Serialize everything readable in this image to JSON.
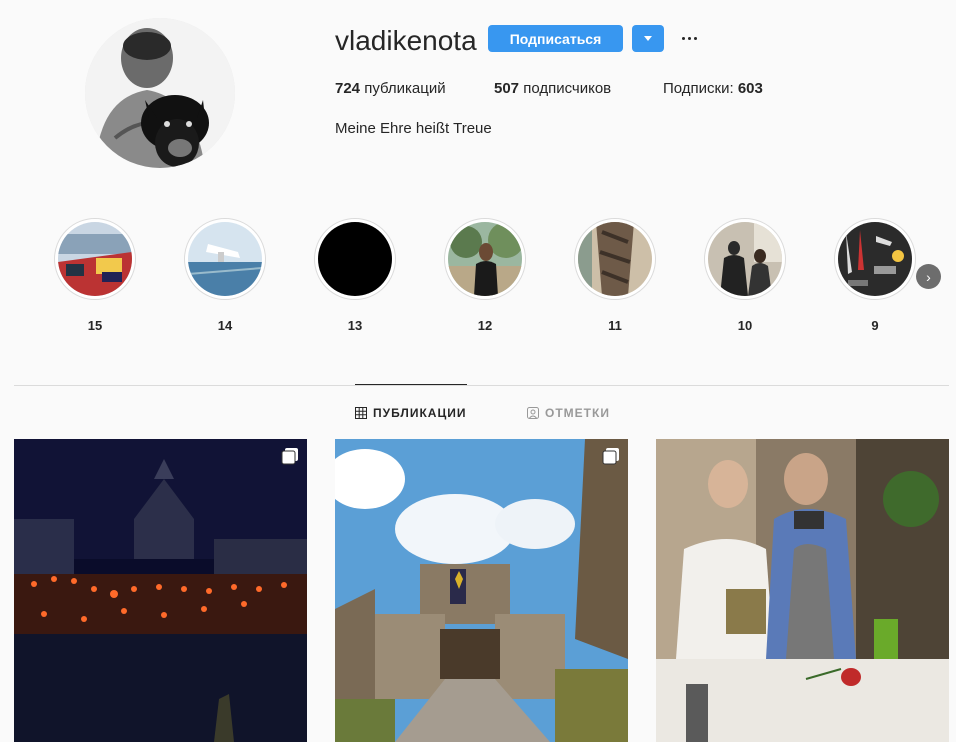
{
  "profile": {
    "username": "vladikenota",
    "follow_label": "Подписаться",
    "posts_count": "724",
    "posts_label": " публикаций",
    "followers_count": "507",
    "followers_label": " подписчиков",
    "following_label": "Подписки: ",
    "following_count": "603",
    "bio": "Meine Ehre heißt Treue"
  },
  "highlights": [
    {
      "label": "15"
    },
    {
      "label": "14"
    },
    {
      "label": "13"
    },
    {
      "label": "12"
    },
    {
      "label": "11"
    },
    {
      "label": "10"
    },
    {
      "label": "9"
    }
  ],
  "tabs": {
    "posts": "ПУБЛИКАЦИИ",
    "tagged": "ОТМЕТКИ"
  },
  "colors": {
    "accent": "#3897f0",
    "text": "#262626",
    "muted": "#999999",
    "border": "#dbdbdb",
    "background": "#fafafa"
  }
}
